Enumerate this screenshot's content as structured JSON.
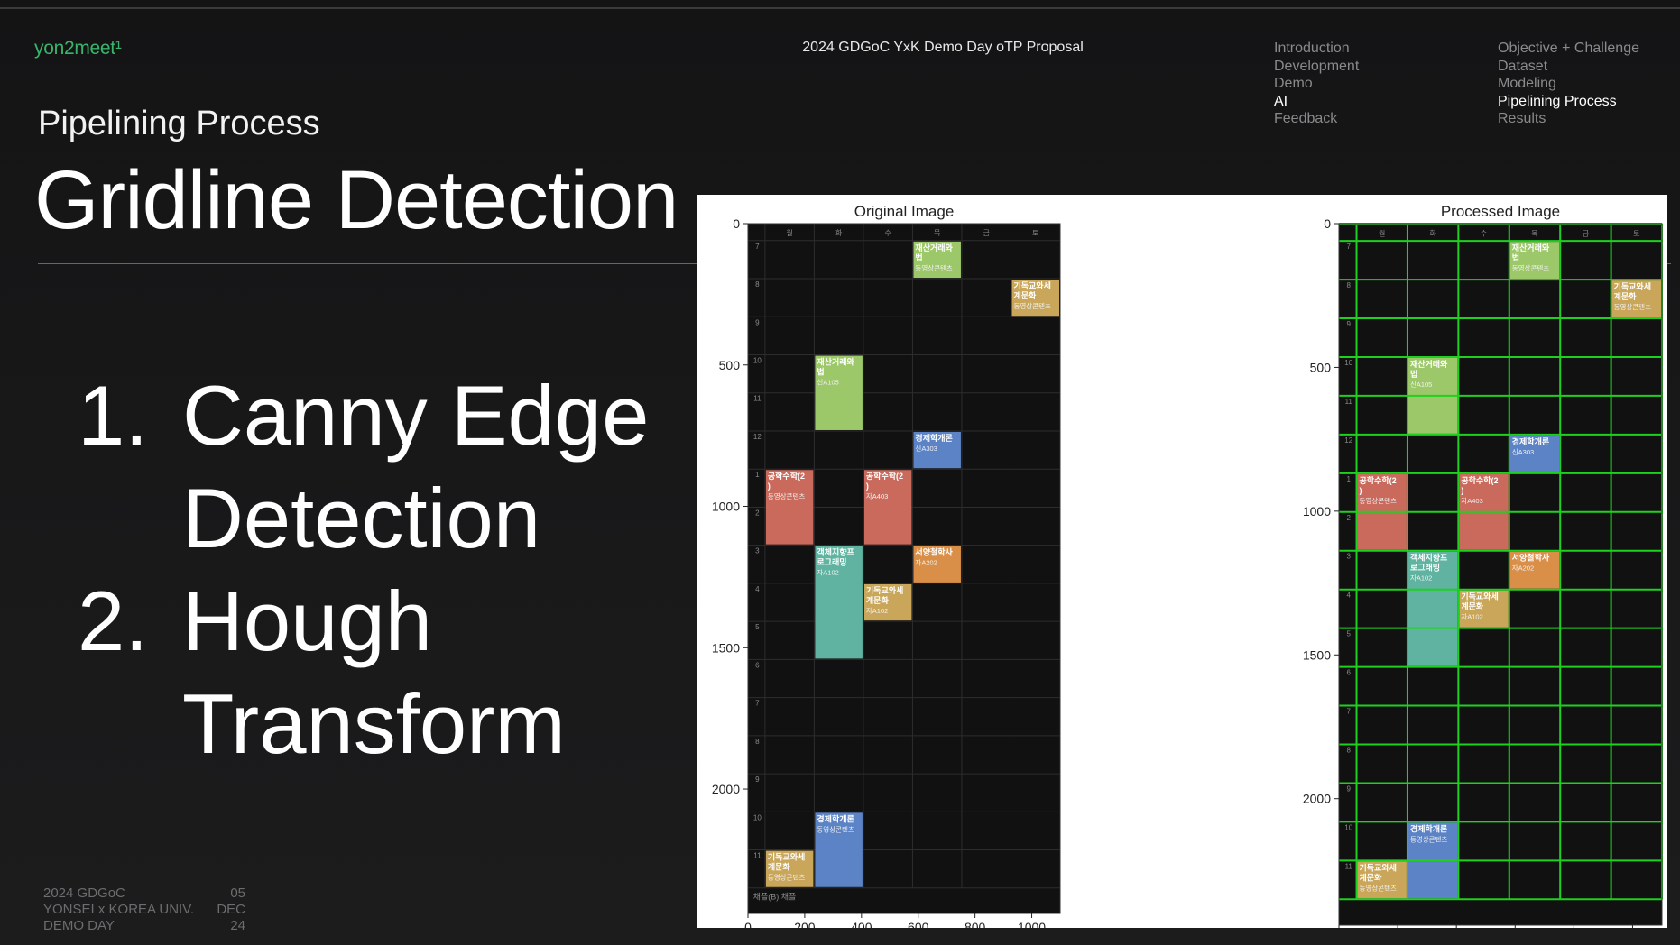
{
  "header": {
    "brand": "yon2meet¹",
    "doc_title": "2024 GDGoC YxK Demo Day oTP Proposal"
  },
  "nav": {
    "col1": [
      {
        "label": "Introduction",
        "active": false
      },
      {
        "label": "Development",
        "active": false
      },
      {
        "label": "Demo",
        "active": false
      },
      {
        "label": "AI",
        "active": true
      },
      {
        "label": "Feedback",
        "active": false
      }
    ],
    "col2": [
      {
        "label": "Objective + Challenge",
        "active": false
      },
      {
        "label": "Dataset",
        "active": false
      },
      {
        "label": "Modeling",
        "active": false
      },
      {
        "label": "Pipelining Process",
        "active": true
      },
      {
        "label": "Results",
        "active": false
      }
    ]
  },
  "slide": {
    "subtitle": "Pipelining Process",
    "headline": "Gridline Detection",
    "steps": [
      {
        "num": "1.",
        "text": "Canny Edge Detection"
      },
      {
        "num": "2.",
        "text": "Hough Transform"
      }
    ]
  },
  "footer": {
    "left": [
      "2024 GDGoC",
      "YONSEI x KOREA UNIV.",
      "DEMO DAY"
    ],
    "right": [
      "05",
      "DEC",
      "24"
    ]
  },
  "colors": {
    "accent_green": "#39b46a",
    "grid_green": "#1fd11f",
    "block_green": "#9dc86a",
    "block_blue": "#5b83c6",
    "block_red": "#c96a5c",
    "block_teal": "#5fb3a0",
    "block_orange": "#d98f48",
    "block_yellow": "#c9a659"
  },
  "chart_data": [
    {
      "type": "image",
      "title": "Original Image",
      "xlim": [
        0,
        1100
      ],
      "ylim": [
        2440,
        0
      ],
      "xticks": [
        0,
        200,
        400,
        600,
        800,
        1000
      ],
      "yticks": [
        0,
        500,
        1000,
        1500,
        2000
      ],
      "day_headers": [
        "월",
        "화",
        "수",
        "목",
        "금",
        "토"
      ],
      "hour_labels": [
        "7",
        "8",
        "9",
        "10",
        "11",
        "12",
        "1",
        "2",
        "3",
        "4",
        "5",
        "6",
        "7",
        "8",
        "9",
        "10",
        "11"
      ],
      "bottom_note": "채플(B)  채플",
      "gridlines": false,
      "blocks": [
        {
          "col": 3,
          "start": 0,
          "end": 1,
          "color": "#9dc86a",
          "title": "재산거래와 법",
          "sub": "동영상콘텐츠"
        },
        {
          "col": 5,
          "start": 1,
          "end": 2,
          "color": "#c9a659",
          "title": "기독교와세 계문화",
          "sub": "동영상콘텐츠"
        },
        {
          "col": 1,
          "start": 3,
          "end": 5,
          "color": "#9dc86a",
          "title": "재산거래와 법",
          "sub": "신A105"
        },
        {
          "col": 3,
          "start": 5,
          "end": 6,
          "color": "#5b83c6",
          "title": "경제학개론",
          "sub": "신A303"
        },
        {
          "col": 0,
          "start": 6,
          "end": 8,
          "color": "#c96a5c",
          "title": "공학수학(2 )",
          "sub": "동영상콘텐츠"
        },
        {
          "col": 2,
          "start": 6,
          "end": 8,
          "color": "#c96a5c",
          "title": "공학수학(2 )",
          "sub": "자A403"
        },
        {
          "col": 1,
          "start": 8,
          "end": 11,
          "color": "#5fb3a0",
          "title": "객체지향프 로그래밍",
          "sub": "자A102"
        },
        {
          "col": 3,
          "start": 8,
          "end": 9,
          "color": "#d98f48",
          "title": "서양철학사",
          "sub": "자A202"
        },
        {
          "col": 2,
          "start": 9,
          "end": 10,
          "color": "#c9a659",
          "title": "기독교와세 계문화",
          "sub": "자A102"
        },
        {
          "col": 1,
          "start": 15,
          "end": 17,
          "color": "#5b83c6",
          "title": "경제학개론",
          "sub": "동영상콘텐츠"
        },
        {
          "col": 0,
          "start": 16,
          "end": 17,
          "color": "#c9a659",
          "title": "기독교와세 계문화",
          "sub": "동영상콘텐츠"
        }
      ]
    },
    {
      "type": "image",
      "title": "Processed Image",
      "xlim": [
        0,
        1100
      ],
      "ylim": [
        2440,
        0
      ],
      "xticks": [
        0,
        200,
        400,
        600,
        800,
        1000
      ],
      "yticks": [
        0,
        500,
        1000,
        1500,
        2000
      ],
      "gridlines": true,
      "note": "same timetable with detected gridlines overlaid in green"
    }
  ]
}
